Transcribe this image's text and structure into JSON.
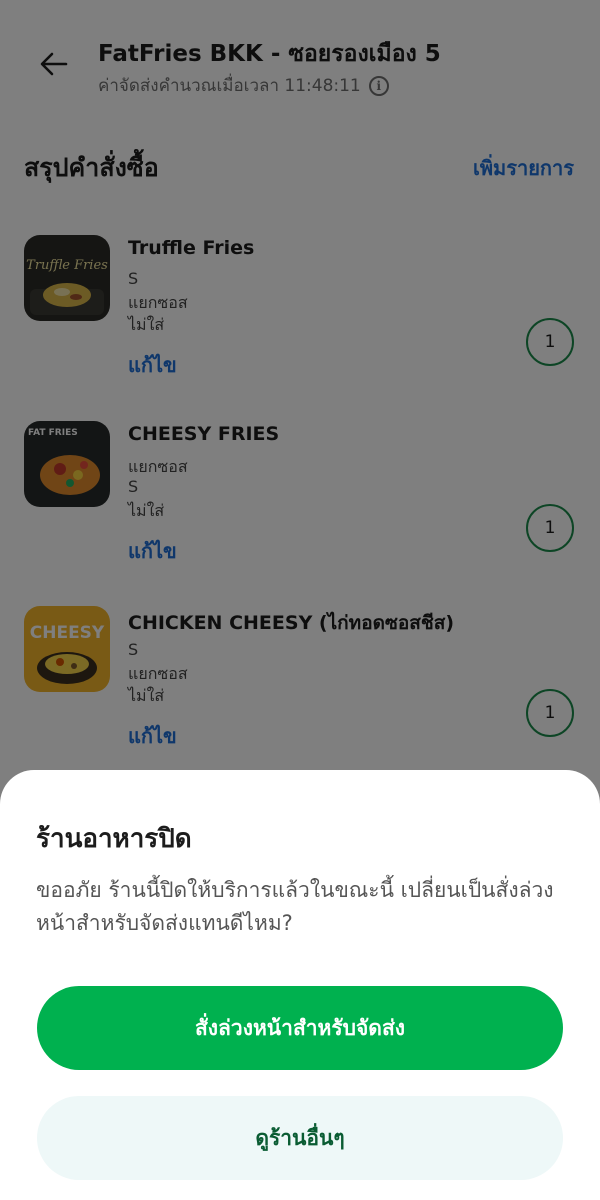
{
  "header": {
    "back_icon": "arrow-left-icon",
    "title": "FatFries BKK - ซอยรองเมือง 5",
    "subtitle": "ค่าจัดส่งคำนวณเมื่อเวลา 11:48:11",
    "info_icon": "info-icon",
    "info_glyph": "i"
  },
  "summary": {
    "title": "สรุปคำสั่งซื้อ",
    "add_items": "เพิ่มรายการ"
  },
  "items": [
    {
      "name": "Truffle Fries",
      "options": [
        "S",
        "แยกซอส",
        "ไม่ใส่"
      ],
      "edit": "แก้ไข",
      "qty": "1",
      "thumb_text": "Truffle Fries"
    },
    {
      "name": "CHEESY FRIES",
      "options": [
        "แยกซอส",
        "S",
        "ไม่ใส่"
      ],
      "edit": "แก้ไข",
      "qty": "1",
      "thumb_text": "FAT FRIES"
    },
    {
      "name": "CHICKEN CHEESY (ไก่ทอดซอสชีส)",
      "options": [
        "S",
        "แยกซอส",
        "ไม่ใส่"
      ],
      "edit": "แก้ไข",
      "qty": "1",
      "thumb_text": "CHEESY"
    }
  ],
  "sheet": {
    "title": "ร้านอาหารปิด",
    "message": "ขออภัย ร้านนี้ปิดให้บริการแล้วในขณะนี้ เปลี่ยนเป็นสั่งล่วงหน้าสำหรับจัดส่งแทนดีไหม?",
    "primary_button": "สั่งล่วงหน้าสำหรับจัดส่ง",
    "secondary_button": "ดูร้านอื่นๆ"
  },
  "colors": {
    "accent_green": "#00b14f",
    "link_blue": "#1f6fd6",
    "secondary_bg": "#eef8f8"
  }
}
